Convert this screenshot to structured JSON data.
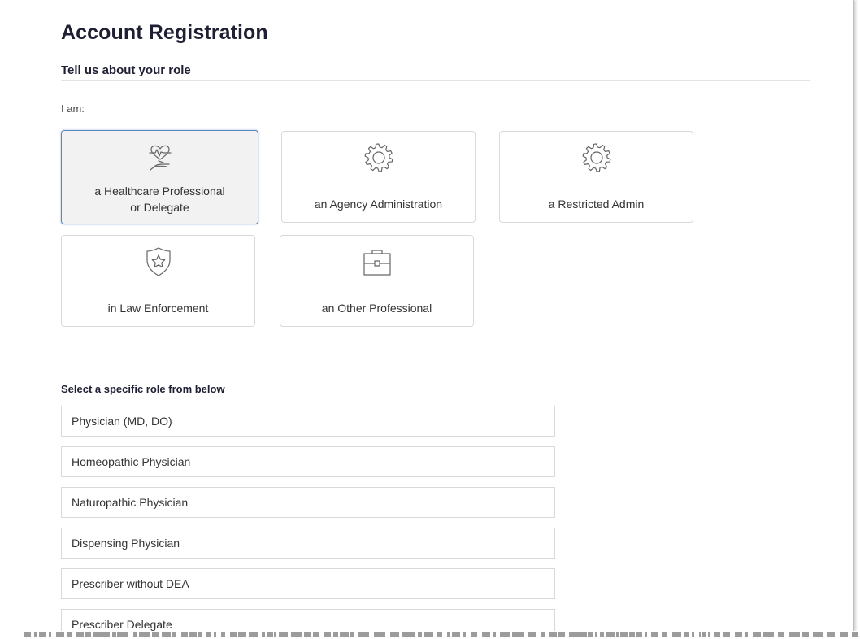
{
  "page": {
    "title": "Account Registration",
    "section_title": "Tell us about your role",
    "iam_label": "I am:"
  },
  "role_cards": [
    {
      "label": "a Healthcare Professional or Delegate",
      "icon": "heart-hand-icon",
      "selected": true
    },
    {
      "label": "an Agency Administration",
      "icon": "gear-icon",
      "selected": false
    },
    {
      "label": "a Restricted Admin",
      "icon": "gear-icon",
      "selected": false
    },
    {
      "label": "in Law Enforcement",
      "icon": "star-badge-icon",
      "selected": false
    },
    {
      "label": "an Other Professional",
      "icon": "briefcase-icon",
      "selected": false
    }
  ],
  "specific_roles": {
    "title": "Select a specific role from below",
    "items": [
      "Physician (MD, DO)",
      "Homeopathic Physician",
      "Naturopathic Physician",
      "Dispensing Physician",
      "Prescriber without DEA",
      "Prescriber Delegate"
    ]
  },
  "colors": {
    "title": "#1f1f33",
    "selected_border": "#5b86c4",
    "selected_bg": "#f2f2f2",
    "card_border": "#d9d9d9",
    "icon_stroke": "#666666"
  }
}
